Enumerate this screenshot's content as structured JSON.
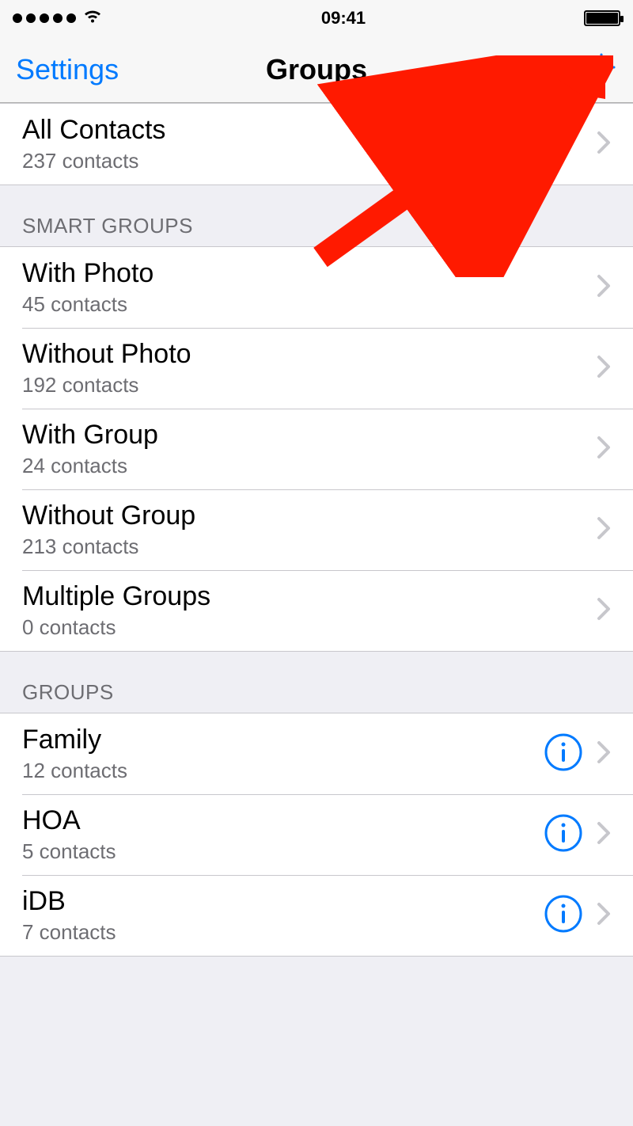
{
  "statusbar": {
    "time": "09:41"
  },
  "nav": {
    "back_label": "Settings",
    "title": "Groups",
    "edit_label": "Edit"
  },
  "all_contacts": {
    "title": "All Contacts",
    "subtitle": "237 contacts"
  },
  "smart_groups": {
    "header": "SMART GROUPS",
    "items": [
      {
        "title": "With Photo",
        "subtitle": "45 contacts"
      },
      {
        "title": "Without Photo",
        "subtitle": "192 contacts"
      },
      {
        "title": "With Group",
        "subtitle": "24 contacts"
      },
      {
        "title": "Without Group",
        "subtitle": "213 contacts"
      },
      {
        "title": "Multiple Groups",
        "subtitle": "0 contacts"
      }
    ]
  },
  "groups": {
    "header": "GROUPS",
    "items": [
      {
        "title": "Family",
        "subtitle": "12 contacts"
      },
      {
        "title": "HOA",
        "subtitle": "5 contacts"
      },
      {
        "title": "iDB",
        "subtitle": "7 contacts"
      }
    ]
  }
}
